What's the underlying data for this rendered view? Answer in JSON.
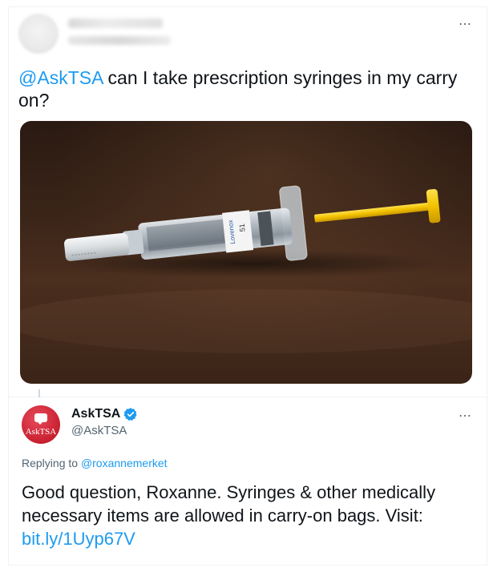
{
  "original_tweet": {
    "author_name": "",
    "author_handle": "",
    "mention": "@AskTSA",
    "text": " can I take prescription syringes in my carry on?",
    "media_description": "",
    "syringe_label": "Lovenox",
    "syringe_number": "51"
  },
  "reply_tweet": {
    "author_name": "AskTSA",
    "author_handle": "@AskTSA",
    "avatar_text": "AskTSA",
    "replying_prefix": "Replying to ",
    "replying_to": "@roxannemerket",
    "text": "Good question, Roxanne. Syringes & other medically necessary items are allowed in carry-on bags. Visit: ",
    "link": "bit.ly/1Uyp67V"
  },
  "more_icon": "⋯",
  "colors": {
    "accent": "#1d9bf0",
    "text": "#0f1419",
    "secondary": "#536471",
    "logo_red": "#c8202f",
    "plunger_yellow": "#f2c200"
  }
}
